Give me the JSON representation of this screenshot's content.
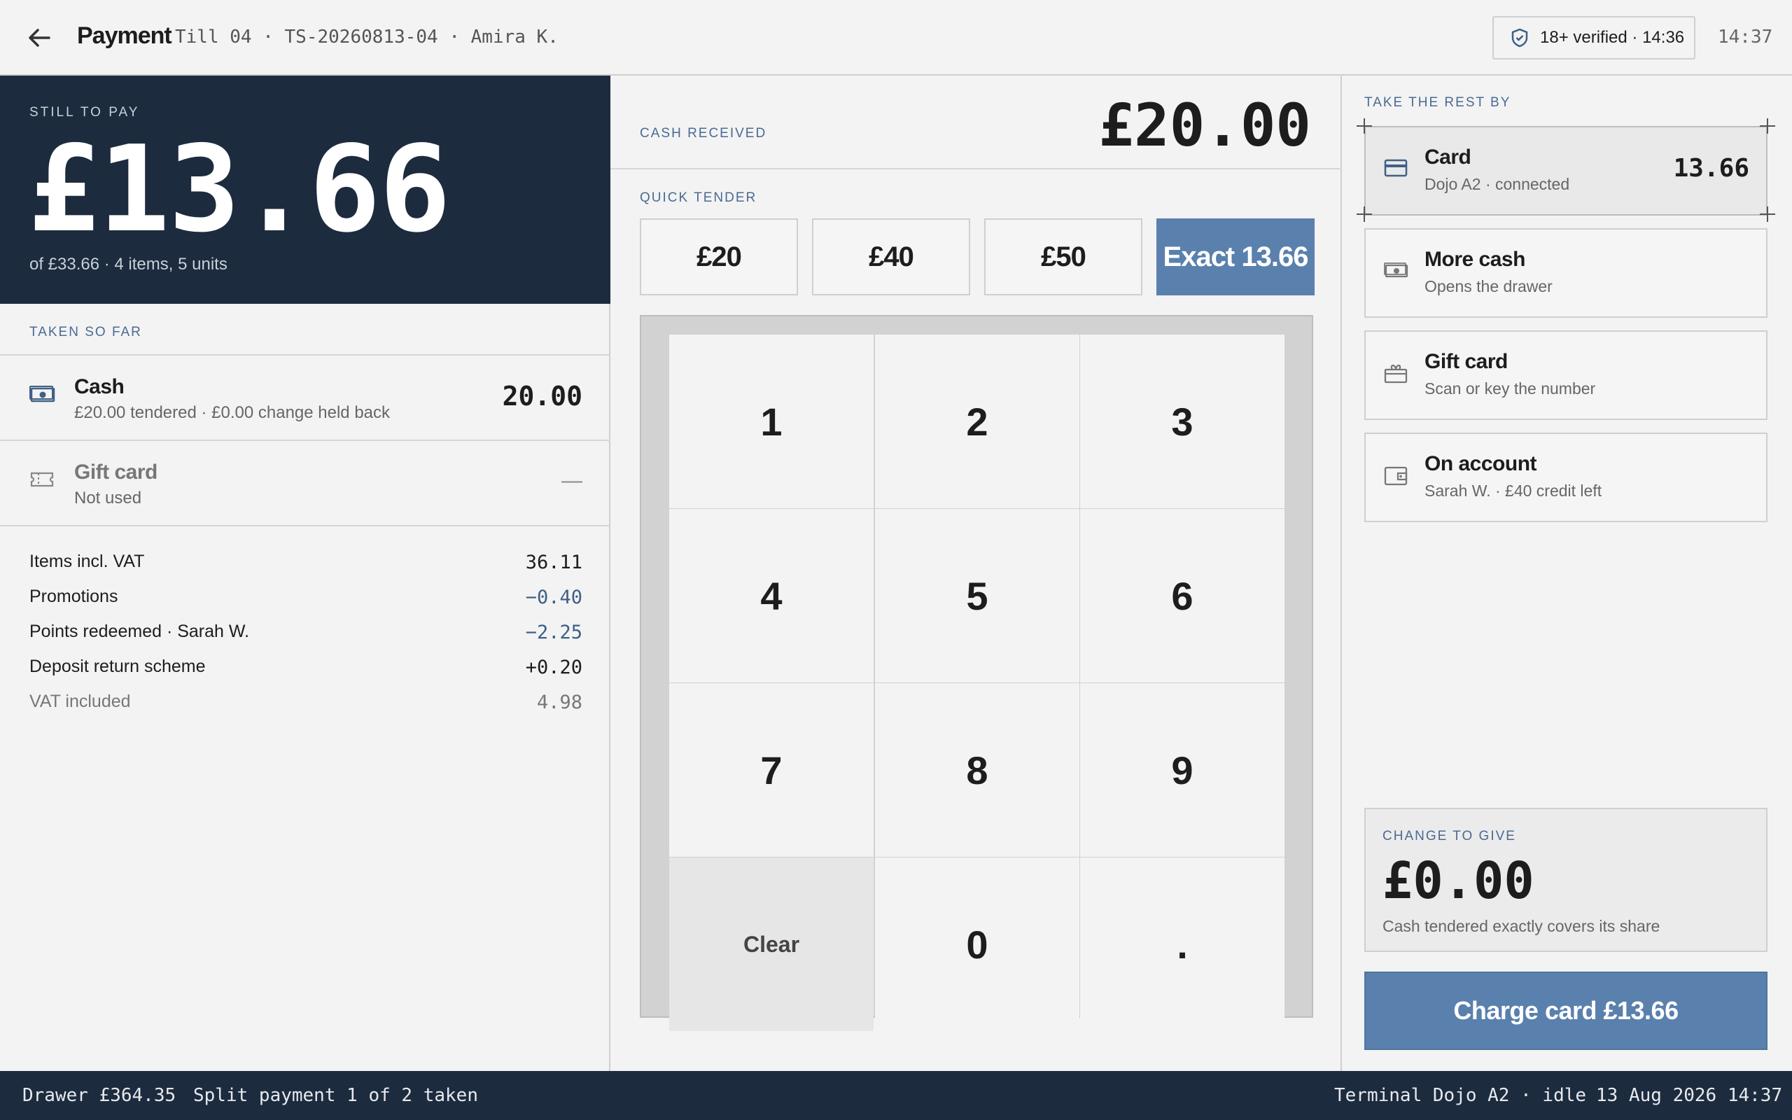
{
  "header": {
    "title": "Payment",
    "meta": "Till 04 · TS-20260813-04 · Amira K.",
    "age_badge": "18+ verified · 14:36",
    "time": "14:37"
  },
  "due": {
    "label": "STILL TO PAY",
    "amount": "£13.66",
    "subtitle": "of £33.66 · 4 items, 5 units"
  },
  "taken": {
    "label": "TAKEN SO FAR",
    "rows": [
      {
        "name": "Cash",
        "desc": "£20.00 tendered · £0.00 change held back",
        "amount": "20.00",
        "icon": "cash-icon"
      },
      {
        "name": "Gift card",
        "desc": "Not used",
        "amount": "—",
        "icon": "gift-card-ticket-icon"
      }
    ]
  },
  "summary": [
    {
      "label": "Items incl. VAT",
      "value": "36.11"
    },
    {
      "label": "Promotions",
      "value": "−0.40"
    },
    {
      "label": "Points redeemed · Sarah W.",
      "value": "−2.25"
    },
    {
      "label": "Deposit return scheme",
      "value": "+0.20"
    },
    {
      "label": "VAT included",
      "value": "4.98"
    }
  ],
  "cash_received": {
    "label": "CASH RECEIVED",
    "amount": "£20.00"
  },
  "quick_tender": {
    "label": "QUICK TENDER",
    "buttons": [
      "£20",
      "£40",
      "£50",
      "Exact 13.66"
    ]
  },
  "keypad": [
    "1",
    "2",
    "3",
    "4",
    "5",
    "6",
    "7",
    "8",
    "9",
    "Clear",
    "0",
    "."
  ],
  "methods": {
    "label": "TAKE THE REST BY",
    "items": [
      {
        "name": "Card",
        "desc": "Dojo A2 · connected",
        "amount": "13.66",
        "icon": "card-icon"
      },
      {
        "name": "More cash",
        "desc": "Opens the drawer",
        "icon": "cash-icon"
      },
      {
        "name": "Gift card",
        "desc": "Scan or key the number",
        "icon": "gift-icon"
      },
      {
        "name": "On account",
        "desc": "Sarah W. · £40 credit left",
        "icon": "wallet-icon"
      }
    ]
  },
  "change": {
    "label": "CHANGE TO GIVE",
    "amount": "£0.00",
    "note": "Cash tendered exactly covers its share"
  },
  "charge_button": "Charge card £13.66",
  "footer": {
    "drawer": "Drawer £364.35",
    "status": "Split payment 1 of 2 taken",
    "terminal": "Terminal Dojo A2 · idle",
    "datetime": "13 Aug 2026 14:37"
  },
  "colors": {
    "navy": "#1d2b3e",
    "accent": "#5a80ad",
    "label_blue": "#4a6a93"
  }
}
